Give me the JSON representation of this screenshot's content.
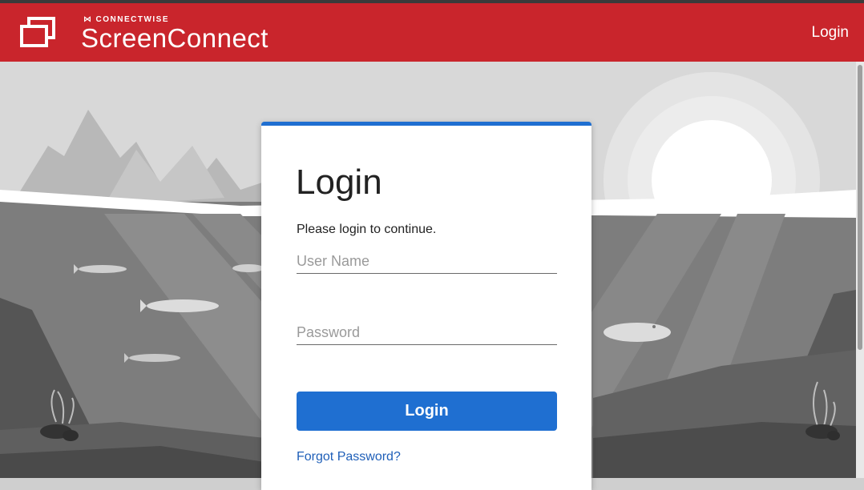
{
  "header": {
    "brand_small": "CONNECTWISE",
    "brand_name": "ScreenConnect",
    "login_link": "Login",
    "bg_color": "#c9252c"
  },
  "login_card": {
    "title": "Login",
    "subtitle": "Please login to continue.",
    "username_placeholder": "User Name",
    "password_placeholder": "Password",
    "submit_label": "Login",
    "forgot_link": "Forgot Password?",
    "accent_color": "#1f6fd1"
  },
  "icons": {
    "logo": "screenconnect-logo-icon",
    "brand_mark": "connectwise-mark-icon"
  }
}
